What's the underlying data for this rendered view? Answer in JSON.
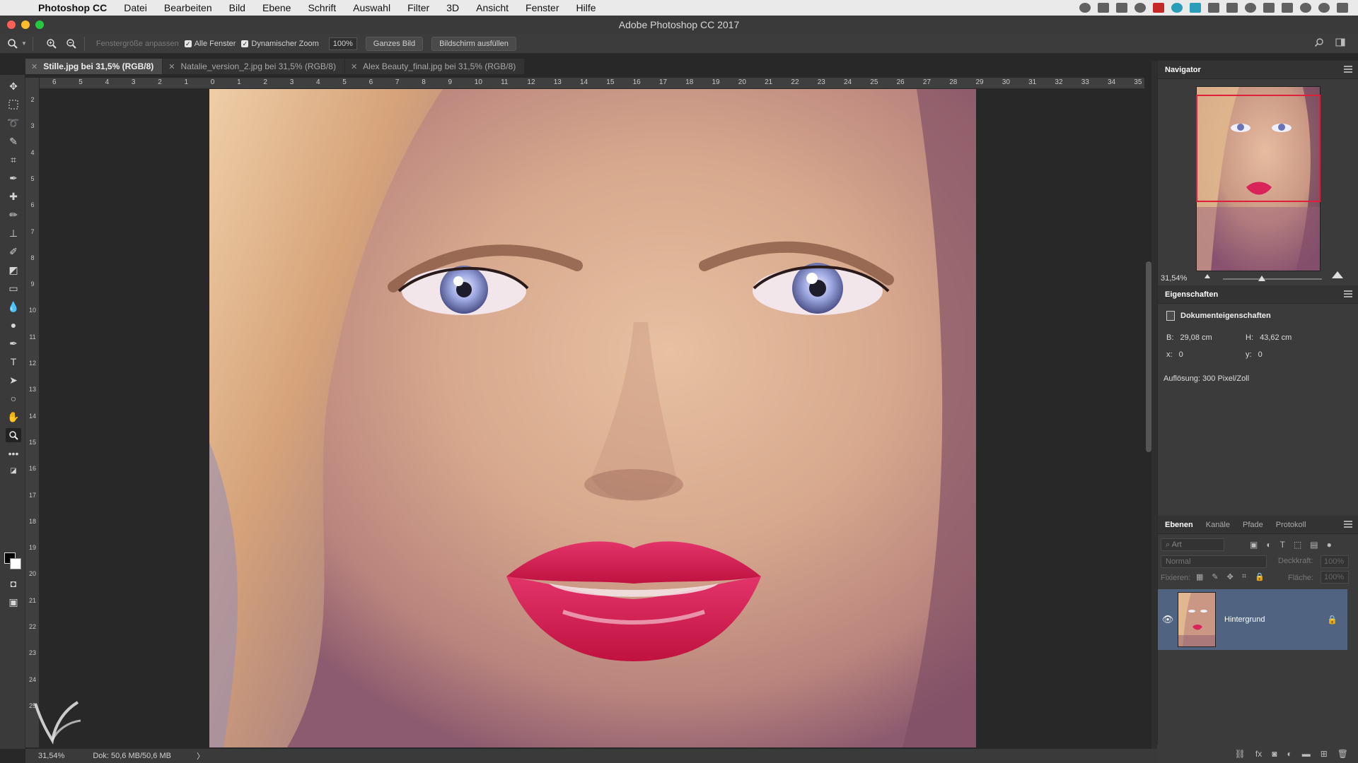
{
  "menubar": {
    "app_name": "Photoshop CC",
    "items": [
      "Datei",
      "Bearbeiten",
      "Bild",
      "Ebene",
      "Schrift",
      "Auswahl",
      "Filter",
      "3D",
      "Ansicht",
      "Fenster",
      "Hilfe"
    ]
  },
  "window": {
    "title": "Adobe Photoshop CC 2017"
  },
  "options": {
    "fit_window_label": "Fenstergröße anpassen",
    "all_windows_label": "Alle Fenster",
    "all_windows_checked": true,
    "dynamic_zoom_label": "Dynamischer Zoom",
    "dynamic_zoom_checked": true,
    "zoom_value": "100%",
    "fit_screen_label": "Ganzes Bild",
    "fill_screen_label": "Bildschirm ausfüllen"
  },
  "tabs": [
    {
      "label": "Stille.jpg bei 31,5% (RGB/8)",
      "active": true
    },
    {
      "label": "Natalie_version_2.jpg bei 31,5% (RGB/8)",
      "active": false
    },
    {
      "label": "Alex Beauty_final.jpg bei 31,5% (RGB/8)",
      "active": false
    }
  ],
  "ruler": {
    "h_labels": [
      "6",
      "5",
      "4",
      "3",
      "2",
      "1",
      "0",
      "1",
      "2",
      "3",
      "4",
      "5",
      "6",
      "7",
      "8",
      "9",
      "10",
      "11",
      "12",
      "13",
      "14",
      "15",
      "16",
      "17",
      "18",
      "19",
      "20",
      "21",
      "22",
      "23",
      "24",
      "25",
      "26",
      "27",
      "28",
      "29",
      "30",
      "31",
      "32",
      "33",
      "34",
      "35"
    ],
    "v_labels": [
      "2",
      "3",
      "4",
      "5",
      "6",
      "7",
      "8",
      "9",
      "10",
      "11",
      "12",
      "13",
      "14",
      "15",
      "16",
      "17",
      "18",
      "19",
      "20",
      "21",
      "22",
      "23",
      "24",
      "25"
    ]
  },
  "statusbar": {
    "zoom": "31,54%",
    "doc_size": "Dok: 50,6 MB/50,6 MB",
    "arrow": "〉"
  },
  "navigator": {
    "title": "Navigator",
    "zoom": "31,54%",
    "view_rect_color": "#e0203a"
  },
  "properties": {
    "title": "Eigenschaften",
    "doc_props_label": "Dokumenteigenschaften",
    "width_label": "B:",
    "width_value": "29,08 cm",
    "height_label": "H:",
    "height_value": "43,62 cm",
    "x_label": "x:",
    "x_value": "0",
    "y_label": "y:",
    "y_value": "0",
    "resolution": "Auflösung: 300 Pixel/Zoll"
  },
  "layers": {
    "tabs": [
      "Ebenen",
      "Kanäle",
      "Pfade",
      "Protokoll"
    ],
    "filter_placeholder": "Art",
    "blend_mode": "Normal",
    "opacity_label": "Deckkraft:",
    "opacity_value": "100%",
    "lock_label": "Fixieren:",
    "fill_label": "Fläche:",
    "fill_value": "100%",
    "layer_name": "Hintergrund",
    "selected_color": "#506482"
  }
}
